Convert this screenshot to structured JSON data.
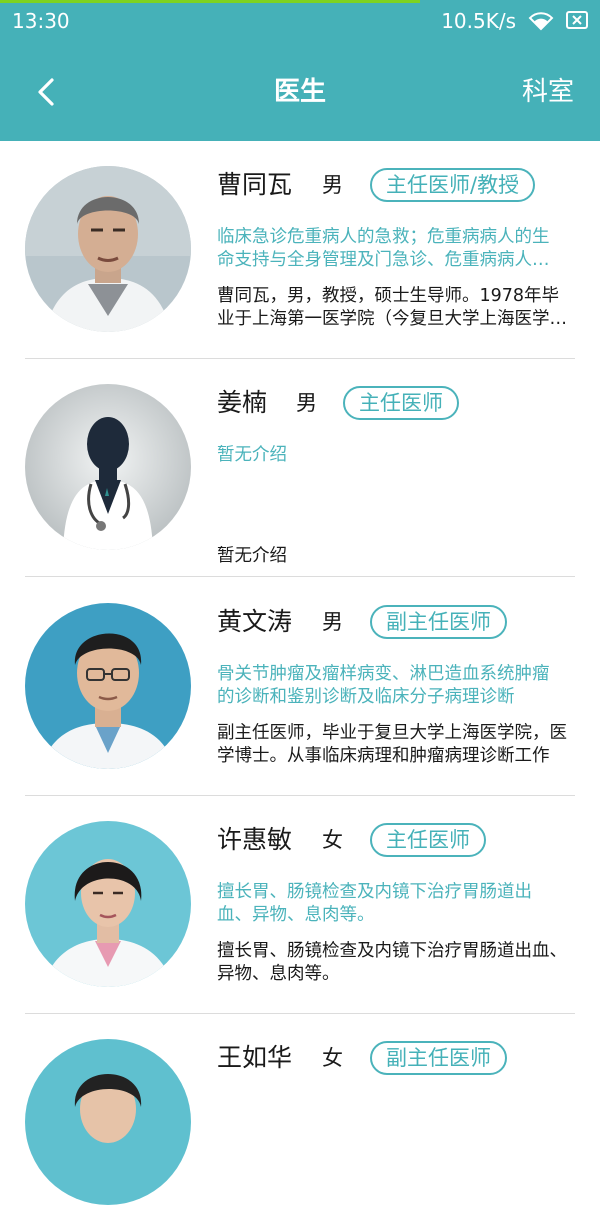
{
  "status_bar": {
    "time": "13:30",
    "net_speed": "10.5K/s",
    "icons": [
      "wifi-icon",
      "battery-icon"
    ]
  },
  "nav": {
    "title": "医生",
    "right_label": "科室",
    "back_icon": "chevron-left-icon"
  },
  "colors": {
    "primary": "#45b1b8",
    "progress": "#7ed321"
  },
  "doctors": [
    {
      "name": "曹同瓦",
      "gender": "男",
      "title": "主任医师/教授",
      "specialty": "临床急诊危重病人的急救；危重病病人的生命支持与全身管理及门急诊、危重病病人的救治",
      "bio": "曹同瓦，男，教授，硕士生导师。1978年毕业于上海第一医学院（今复旦大学上海医学院）"
    },
    {
      "name": "姜楠",
      "gender": "男",
      "title": "主任医师",
      "specialty": "暂无介绍",
      "bio": "暂无介绍"
    },
    {
      "name": "黄文涛",
      "gender": "男",
      "title": "副主任医师",
      "specialty": "骨关节肿瘤及瘤样病变、淋巴造血系统肿瘤的诊断和鉴别诊断及临床分子病理诊断",
      "bio": "副主任医师，毕业于复旦大学上海医学院，医学博士。从事临床病理和肿瘤病理诊断工作"
    },
    {
      "name": "许惠敏",
      "gender": "女",
      "title": "主任医师",
      "specialty": "擅长胃、肠镜检查及内镜下治疗胃肠道出血、异物、息肉等。",
      "bio": "擅长胃、肠镜检查及内镜下治疗胃肠道出血、异物、息肉等。"
    },
    {
      "name": "王如华",
      "gender": "女",
      "title": "副主任医师",
      "specialty": "",
      "bio": ""
    }
  ]
}
